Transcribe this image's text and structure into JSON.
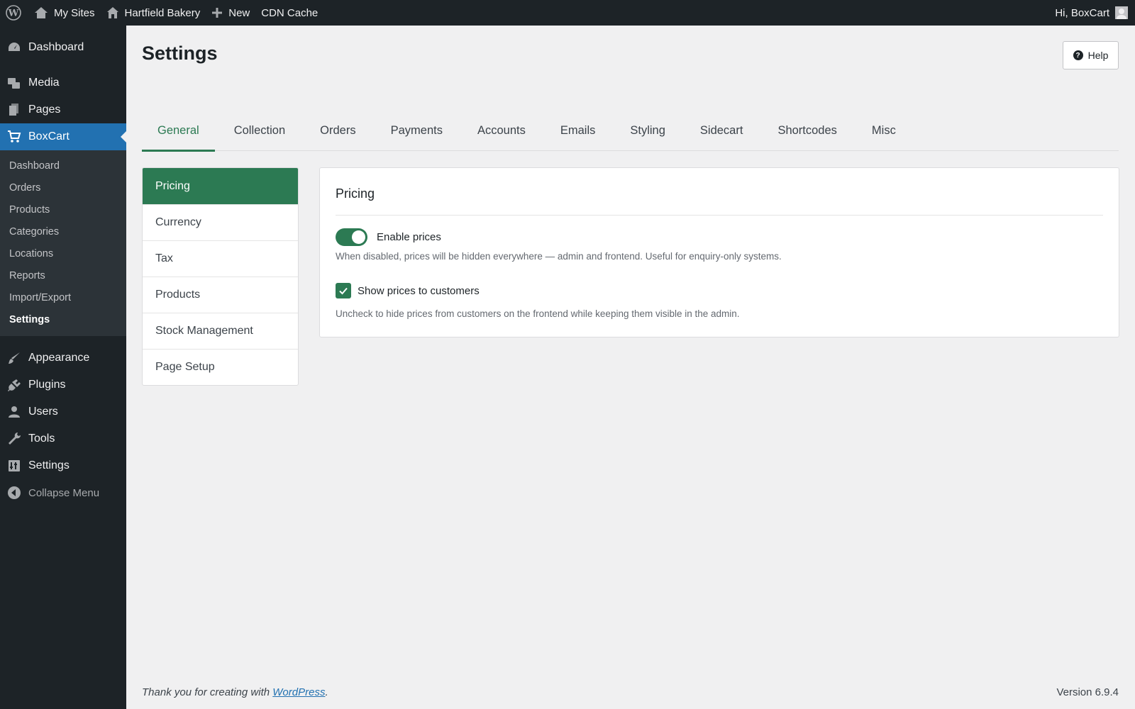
{
  "adminbar": {
    "my_sites": "My Sites",
    "site_name": "Hartfield Bakery",
    "new": "New",
    "cdn": "CDN Cache",
    "greeting": "Hi, BoxCart"
  },
  "sidebar": {
    "items": [
      {
        "label": "Dashboard",
        "icon": "dashboard-icon"
      },
      {
        "label": "Media",
        "icon": "media-icon"
      },
      {
        "label": "Pages",
        "icon": "pages-icon"
      },
      {
        "label": "BoxCart",
        "icon": "cart-icon"
      }
    ],
    "submenu": [
      "Dashboard",
      "Orders",
      "Products",
      "Categories",
      "Locations",
      "Reports",
      "Import/Export",
      "Settings"
    ],
    "items_bottom": [
      {
        "label": "Appearance",
        "icon": "appearance-icon"
      },
      {
        "label": "Plugins",
        "icon": "plugins-icon"
      },
      {
        "label": "Users",
        "icon": "users-icon"
      },
      {
        "label": "Tools",
        "icon": "tools-icon"
      },
      {
        "label": "Settings",
        "icon": "settings-icon"
      }
    ],
    "collapse": "Collapse Menu"
  },
  "page": {
    "title": "Settings",
    "help": "Help"
  },
  "tabs": [
    "General",
    "Collection",
    "Orders",
    "Payments",
    "Accounts",
    "Emails",
    "Styling",
    "Sidecart",
    "Shortcodes",
    "Misc"
  ],
  "subnav": [
    "Pricing",
    "Currency",
    "Tax",
    "Products",
    "Stock Management",
    "Page Setup"
  ],
  "panel": {
    "title": "Pricing",
    "enable_prices_label": "Enable prices",
    "enable_prices_on": true,
    "enable_prices_desc": "When disabled, prices will be hidden everywhere — admin and frontend. Useful for enquiry-only systems.",
    "show_prices_label": "Show prices to customers",
    "show_prices_checked": true,
    "show_prices_desc": "Uncheck to hide prices from customers on the frontend while keeping them visible in the admin."
  },
  "footer": {
    "thanks_prefix": "Thank you for creating with ",
    "link": "WordPress",
    "suffix": ".",
    "version": "Version 6.9.4"
  },
  "colors": {
    "accent": "#2c7a53",
    "wp_blue": "#2271b1",
    "admin_dark": "#1d2327"
  }
}
